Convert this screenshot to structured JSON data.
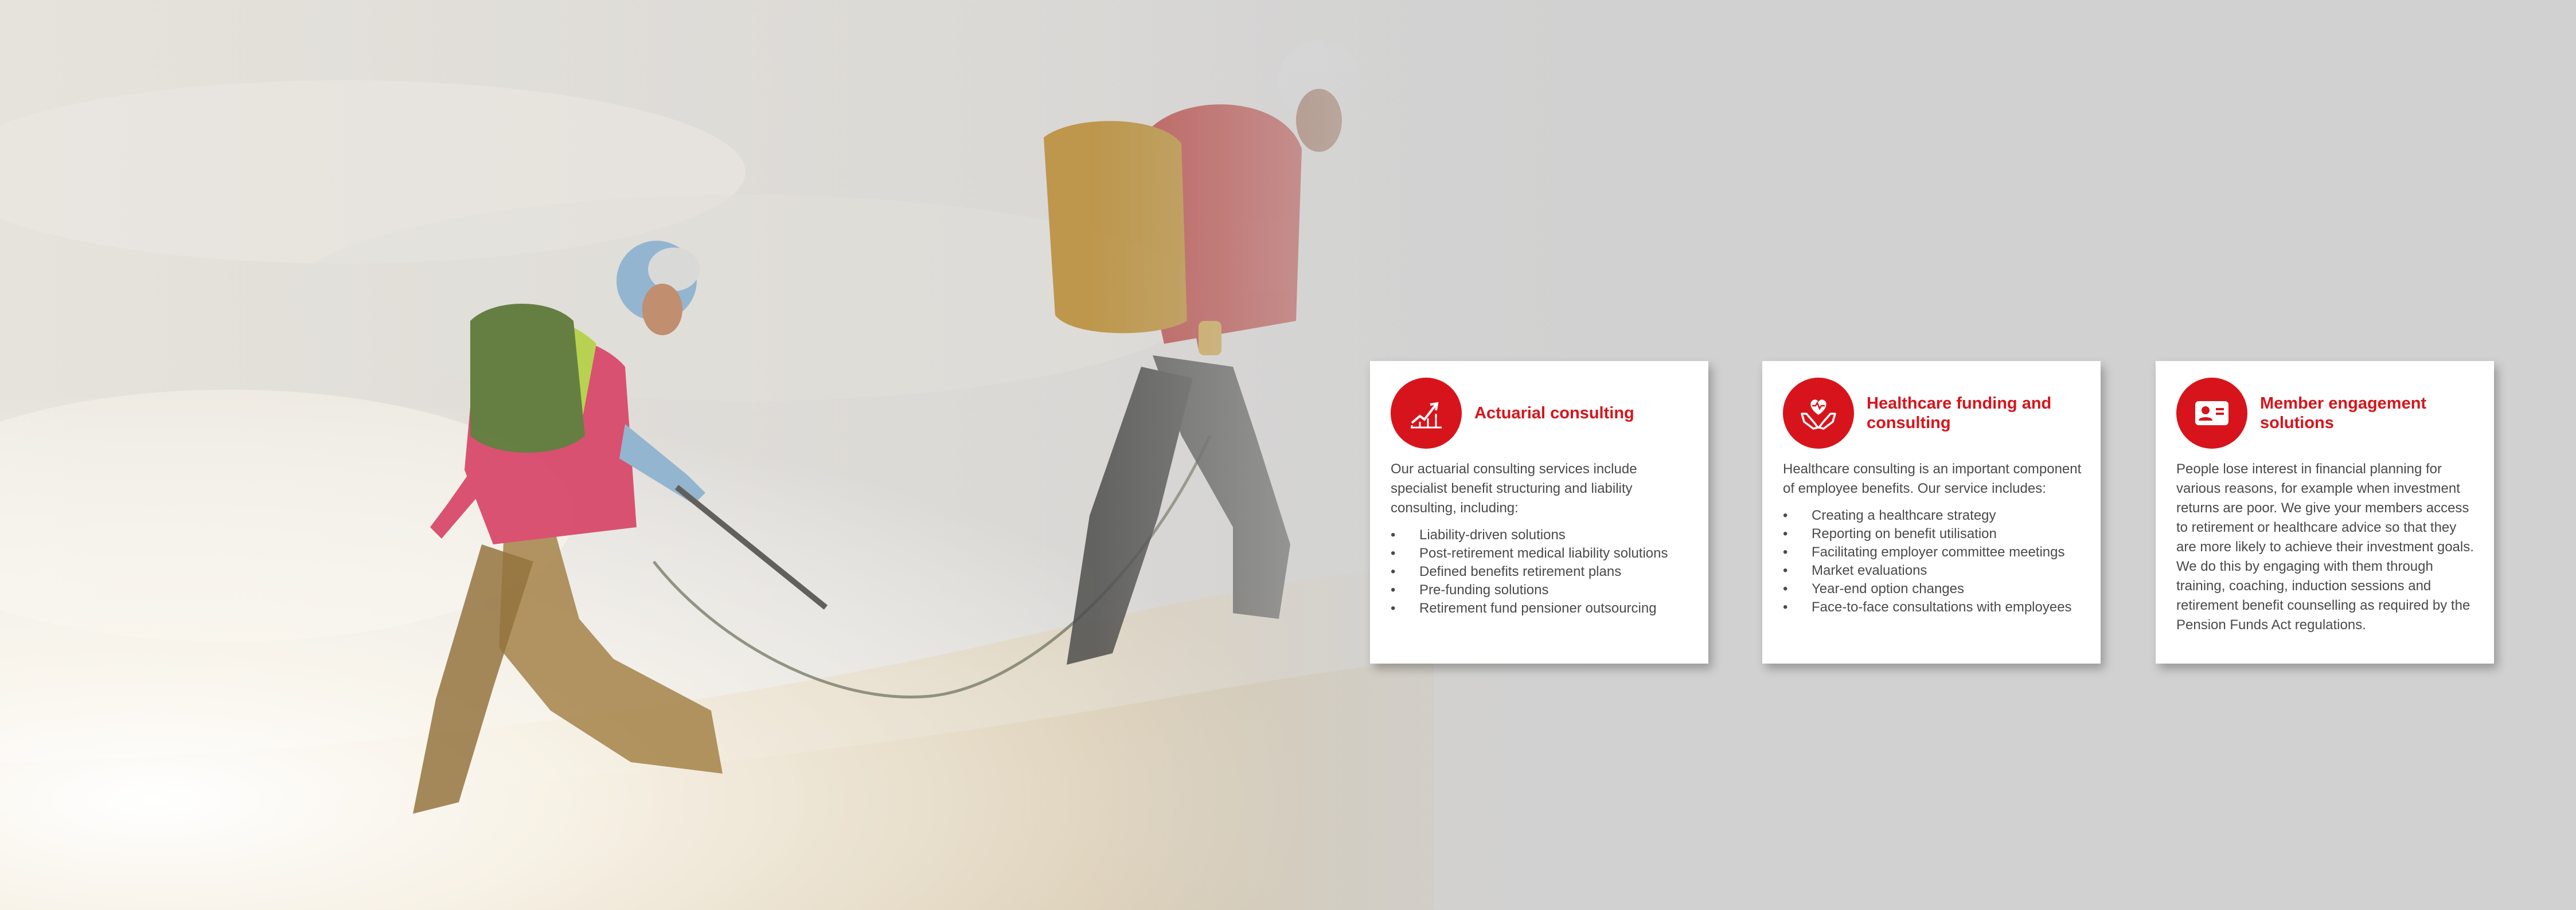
{
  "colors": {
    "accent": "#d7141b",
    "body_text": "#4a4a4a",
    "background": "#d1d1d1",
    "card": "#ffffff"
  },
  "hero": {
    "description_icon": "mountaineers-photo"
  },
  "cards": [
    {
      "icon": "growth-chart-icon",
      "title": "Actuarial consulting",
      "intro": "Our actuarial consulting services include specialist benefit structuring and liability consulting, including:",
      "items": [
        "Liability-driven solutions",
        "Post-retirement medical liability solutions",
        "Defined benefits retirement plans",
        "Pre-funding solutions",
        "Retirement fund pensioner outsourcing"
      ]
    },
    {
      "icon": "heart-hands-icon",
      "title": "Healthcare funding and consulting",
      "intro": "Healthcare consulting is an important component of employee benefits. Our service includes:",
      "items": [
        "Creating a healthcare strategy",
        "Reporting on benefit utilisation",
        "Facilitating employer committee meetings",
        "Market evaluations",
        "Year-end option changes",
        "Face-to-face consultations with employees"
      ]
    },
    {
      "icon": "member-card-icon",
      "title": "Member engagement solutions",
      "intro": "People lose interest in financial planning for various reasons, for example when investment returns are poor. We give your members access to retirement or healthcare advice so that they are more likely to achieve their investment goals. We do this by engaging with them through training, coaching, induction sessions and retirement benefit counselling as required by the Pension Funds Act regulations.",
      "items": []
    }
  ]
}
